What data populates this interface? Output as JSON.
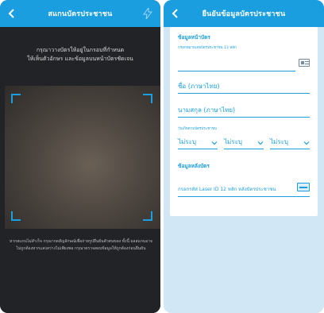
{
  "scan_screen": {
    "title": "สแกนบัตรประชาชน",
    "back_icon": "chevron-left-icon",
    "flash_icon": "flash-icon",
    "instruction_line1": "กรุณาวางบัตรให้อยู่ในกรอบที่กำหนด",
    "instruction_line2": "ให้เห็นตัวอักษร และข้อมูลบนหน้าบัตรชัดเจน",
    "disclaimer": "หากสแกนไม่สำเร็จ กรุณากดสัญลักษณ์เพื่อถ่ายรูปยืนยันตัวตนของ ทั้งนี้ ผลสแกนอาจไม่ถูกต้องหากแสงสว่างไม่เพียงพอ กรุณาตรวจสอบข้อมูลให้ถูกต้องก่อนยืนยัน"
  },
  "confirm_screen": {
    "title": "ยืนยันข้อมูลบัตรประชาชน",
    "back_icon": "chevron-left-icon",
    "front_section": "ข้อมูลหน้าบัตร",
    "id_label": "กรอกหมายเลขบัตรประชาชน 13 หลัก",
    "first_name_placeholder": "ชื่อ (ภาษาไทย)",
    "last_name_placeholder": "นามสกุล (ภาษาไทย)",
    "dob_label": "วันเกิดตามบัตรประชาชน",
    "day_value": "ไม่ระบุ",
    "month_value": "ไม่ระบุ",
    "year_value": "ไม่ระบุ",
    "back_section": "ข้อมูลหลังบัตร",
    "laser_placeholder": "กรอกรหัส Laser ID 12 หลัก หลังบัตรประชาชน"
  },
  "colors": {
    "primary": "#1a9ee0",
    "scan_background": "#222326",
    "form_background": "#d2e7f6"
  }
}
